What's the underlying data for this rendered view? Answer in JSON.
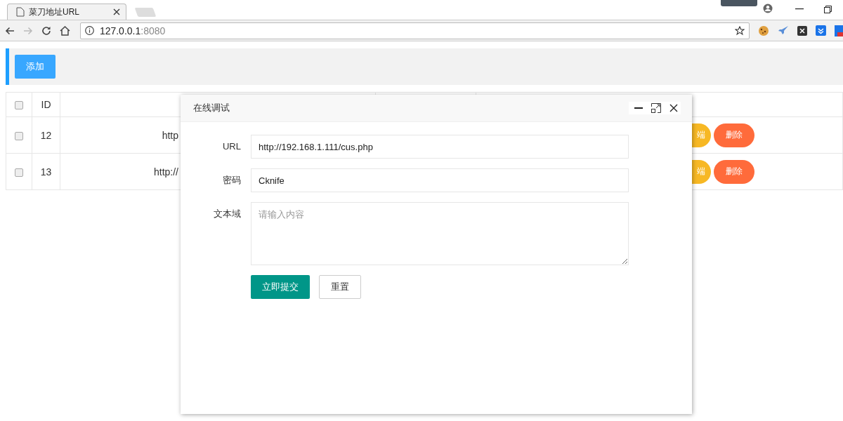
{
  "browser": {
    "tab": {
      "title": "菜刀地址URL"
    },
    "address": {
      "host": "127.0.0.1",
      "port": ":8080"
    }
  },
  "toolbar": {
    "add_button": "添加"
  },
  "table": {
    "header": {
      "checked": false,
      "id": "ID"
    },
    "rows": [
      {
        "checked": false,
        "id": "12",
        "url": "http",
        "action_1": "端",
        "delete": "删除"
      },
      {
        "checked": false,
        "id": "13",
        "url": "http://",
        "action_1": "端",
        "delete": "删除"
      }
    ]
  },
  "dialog": {
    "title": "在线调试",
    "fields": [
      {
        "label": "URL",
        "value": "http://192.168.1.111/cus.php"
      },
      {
        "label": "密码",
        "value": "Cknife"
      }
    ],
    "textarea": {
      "label": "文本域",
      "placeholder": "请输入内容"
    },
    "buttons": {
      "submit": "立即提交",
      "reset": "重置"
    }
  }
}
